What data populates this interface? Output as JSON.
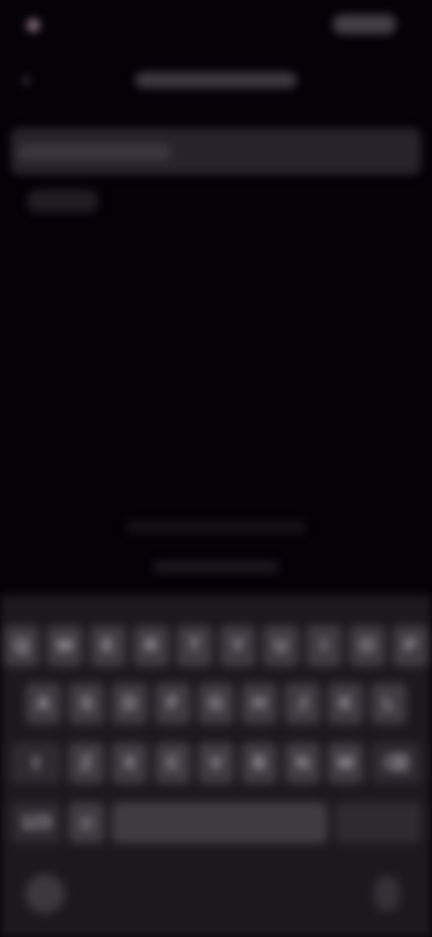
{
  "status_bar": {
    "time": ""
  },
  "top_bar": {
    "back_icon": "chevron-left-icon",
    "title": ""
  },
  "search": {
    "placeholder": "",
    "value": ""
  },
  "keyboard": {
    "row1": [
      "Q",
      "W",
      "E",
      "R",
      "T",
      "Y",
      "U",
      "I",
      "O",
      "P"
    ],
    "row2": [
      "A",
      "S",
      "D",
      "F",
      "G",
      "H",
      "J",
      "K",
      "L"
    ],
    "row3": [
      "Z",
      "X",
      "C",
      "V",
      "B",
      "N",
      "M"
    ],
    "shift_icon": "shift-icon",
    "delete_icon": "backspace-icon",
    "numbers_key": "123",
    "emoji_icon": "emoji-icon",
    "space_label": "",
    "return_label": "",
    "globe_icon": "globe-icon",
    "mic_icon": "microphone-icon"
  }
}
